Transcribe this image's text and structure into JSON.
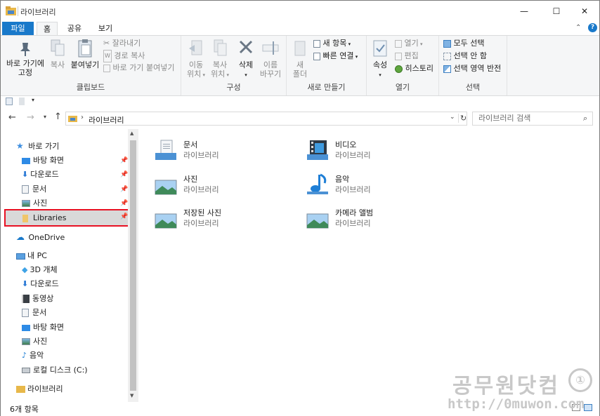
{
  "window": {
    "title": "라이브러리",
    "min": "—",
    "max": "☐",
    "close": "✕"
  },
  "tabs": [
    "파일",
    "홈",
    "공유",
    "보기"
  ],
  "ribbon": {
    "clipboard": {
      "label": "클립보드",
      "pin": [
        "바로 가기에",
        "고정"
      ],
      "copy": "복사",
      "paste": "붙여넣기",
      "cut": "잘라내기",
      "copy_path": "경로 복사",
      "paste_shortcut": "바로 가기 붙여넣기"
    },
    "organize": {
      "label": "구성",
      "move": [
        "이동",
        "위치"
      ],
      "copyto": [
        "복사",
        "위치"
      ],
      "delete": "삭제",
      "rename": [
        "이름",
        "바꾸기"
      ]
    },
    "new": {
      "label": "새로 만들기",
      "new_folder": [
        "새",
        "폴더"
      ],
      "new_item": "새 항목",
      "easy_access": "빠른 연결"
    },
    "open": {
      "label": "열기",
      "properties": "속성",
      "open": "열기",
      "edit": "편집",
      "history": "히스토리"
    },
    "select": {
      "label": "선택",
      "select_all": "모두 선택",
      "select_none": "선택 안 함",
      "invert": "선택 영역 반전"
    }
  },
  "address": {
    "path": "라이브러리",
    "search_placeholder": "라이브러리 검색"
  },
  "nav": {
    "quick_access": "바로 가기",
    "quick": [
      "바탕 화면",
      "다운로드",
      "문서",
      "사진",
      "Libraries"
    ],
    "onedrive": "OneDrive",
    "thispc": "내 PC",
    "pc": [
      "3D 개체",
      "다운로드",
      "동영상",
      "문서",
      "바탕 화면",
      "사진",
      "음악",
      "로컬 디스크 (C:)"
    ],
    "libraries": "라이브러리"
  },
  "items": [
    {
      "name": "문서",
      "type": "라이브러리"
    },
    {
      "name": "비디오",
      "type": "라이브러리"
    },
    {
      "name": "사진",
      "type": "라이브러리"
    },
    {
      "name": "음악",
      "type": "라이브러리"
    },
    {
      "name": "저장된 사진",
      "type": "라이브러리"
    },
    {
      "name": "카메라 앨범",
      "type": "라이브러리"
    }
  ],
  "status": {
    "count": "6개 항목"
  },
  "watermark": {
    "brand": "공무원닷컴",
    "url": "http://0muwon.com"
  },
  "colors": {
    "accent": "#1979ca",
    "highlight_border": "#e81123"
  }
}
